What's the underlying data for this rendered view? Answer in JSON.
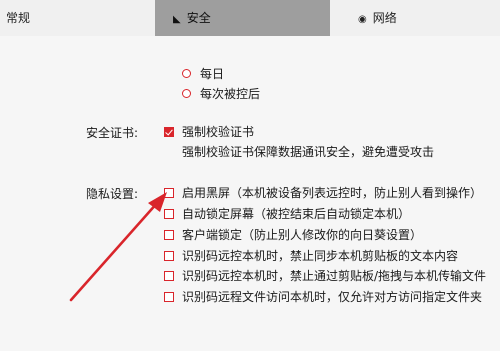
{
  "tabs": [
    {
      "label": "常规",
      "icon": ""
    },
    {
      "label": "安全",
      "icon": "shield-icon",
      "glyph": "◣"
    },
    {
      "label": "网络",
      "icon": "globe-icon",
      "glyph": "◉"
    }
  ],
  "control_mode": {
    "options": [
      {
        "label": "每日"
      },
      {
        "label": "每次被控后"
      }
    ]
  },
  "certificate": {
    "label": "安全证书:",
    "checkbox_label": "强制校验证书",
    "checked": true,
    "description": "强制校验证书保障数据通讯安全，避免遭受攻击"
  },
  "privacy": {
    "label": "隐私设置:",
    "items": [
      {
        "label": "启用黑屏（本机被设备列表远控时，防止别人看到操作）",
        "checked": false
      },
      {
        "label": "自动锁定屏幕（被控结束后自动锁定本机）",
        "checked": false
      },
      {
        "label": "客户端锁定（防止别人修改你的向日葵设置）",
        "checked": false
      },
      {
        "label": "识别码远控本机时，禁止同步本机剪贴板的文本内容",
        "checked": false
      },
      {
        "label": "识别码远控本机时，禁止通过剪贴板/拖拽与本机传输文件",
        "checked": false
      },
      {
        "label": "识别码远程文件访问本机时，仅允许对方访问指定文件夹",
        "checked": false
      }
    ]
  },
  "colors": {
    "accent": "#d9252b",
    "arrow": "#d9252b",
    "active_tab": "#9e9e9e"
  }
}
